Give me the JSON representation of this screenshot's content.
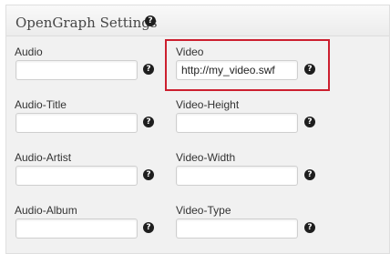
{
  "header": {
    "title": "OpenGraph Settings",
    "help_glyph": "?"
  },
  "fields": [
    {
      "label": "Audio",
      "value": "",
      "placeholder": ""
    },
    {
      "label": "Video",
      "value": "http://my_video.swf",
      "placeholder": ""
    },
    {
      "label": "Audio-Title",
      "value": "",
      "placeholder": ""
    },
    {
      "label": "Video-Height",
      "value": "",
      "placeholder": ""
    },
    {
      "label": "Audio-Artist",
      "value": "",
      "placeholder": ""
    },
    {
      "label": "Video-Width",
      "value": "",
      "placeholder": ""
    },
    {
      "label": "Audio-Album",
      "value": "",
      "placeholder": ""
    },
    {
      "label": "Video-Type",
      "value": "",
      "placeholder": ""
    }
  ],
  "icons": {
    "help": "question-help-icon"
  },
  "colors": {
    "highlight_border": "#cc1f2f",
    "panel_bg": "#f1f1f1",
    "help_icon_bg": "#1e1e1e"
  }
}
